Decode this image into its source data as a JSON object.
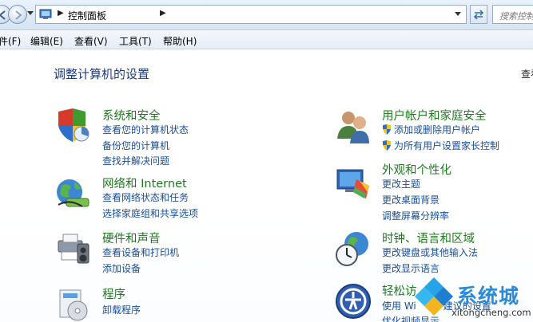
{
  "address_bar": {
    "location": "控制面板",
    "search_placeholder": "搜索控制"
  },
  "menu": [
    "件(F)",
    "编辑(E)",
    "查看(V)",
    "工具(T)",
    "帮助(H)"
  ],
  "main": {
    "title": "调整计算机的设置",
    "view_by": "查看"
  },
  "categories": {
    "security": {
      "title": "系统和安全",
      "links": [
        "查看您的计算机状态",
        "备份您的计算机",
        "查找并解决问题"
      ]
    },
    "network": {
      "title": "网络和 Internet",
      "links": [
        "查看网络状态和任务",
        "选择家庭组和共享选项"
      ]
    },
    "hardware": {
      "title": "硬件和声音",
      "links": [
        "查看设备和打印机",
        "添加设备"
      ]
    },
    "programs": {
      "title": "程序",
      "links": [
        "卸载程序"
      ]
    },
    "users": {
      "title": "用户帐户和家庭安全",
      "links": [
        "添加或删除用户帐户",
        "为所有用户设置家长控制"
      ]
    },
    "appearance": {
      "title": "外观和个性化",
      "links": [
        "更改主题",
        "更改桌面背景",
        "调整屏幕分辨率"
      ]
    },
    "clock": {
      "title": "时钟、语言和区域",
      "links": [
        "更改键盘或其他输入法",
        "更改显示语言"
      ]
    },
    "ease": {
      "title": "轻松访",
      "links": [
        "使用 Wi",
        "建议的设置",
        "优化视频显示"
      ]
    }
  },
  "watermark": {
    "brand": "系统城",
    "url": "xitongcheng.com"
  },
  "colors": {
    "category_title": "#1e7b1e",
    "link": "#1a4fa0",
    "heading": "#1f3b78"
  }
}
